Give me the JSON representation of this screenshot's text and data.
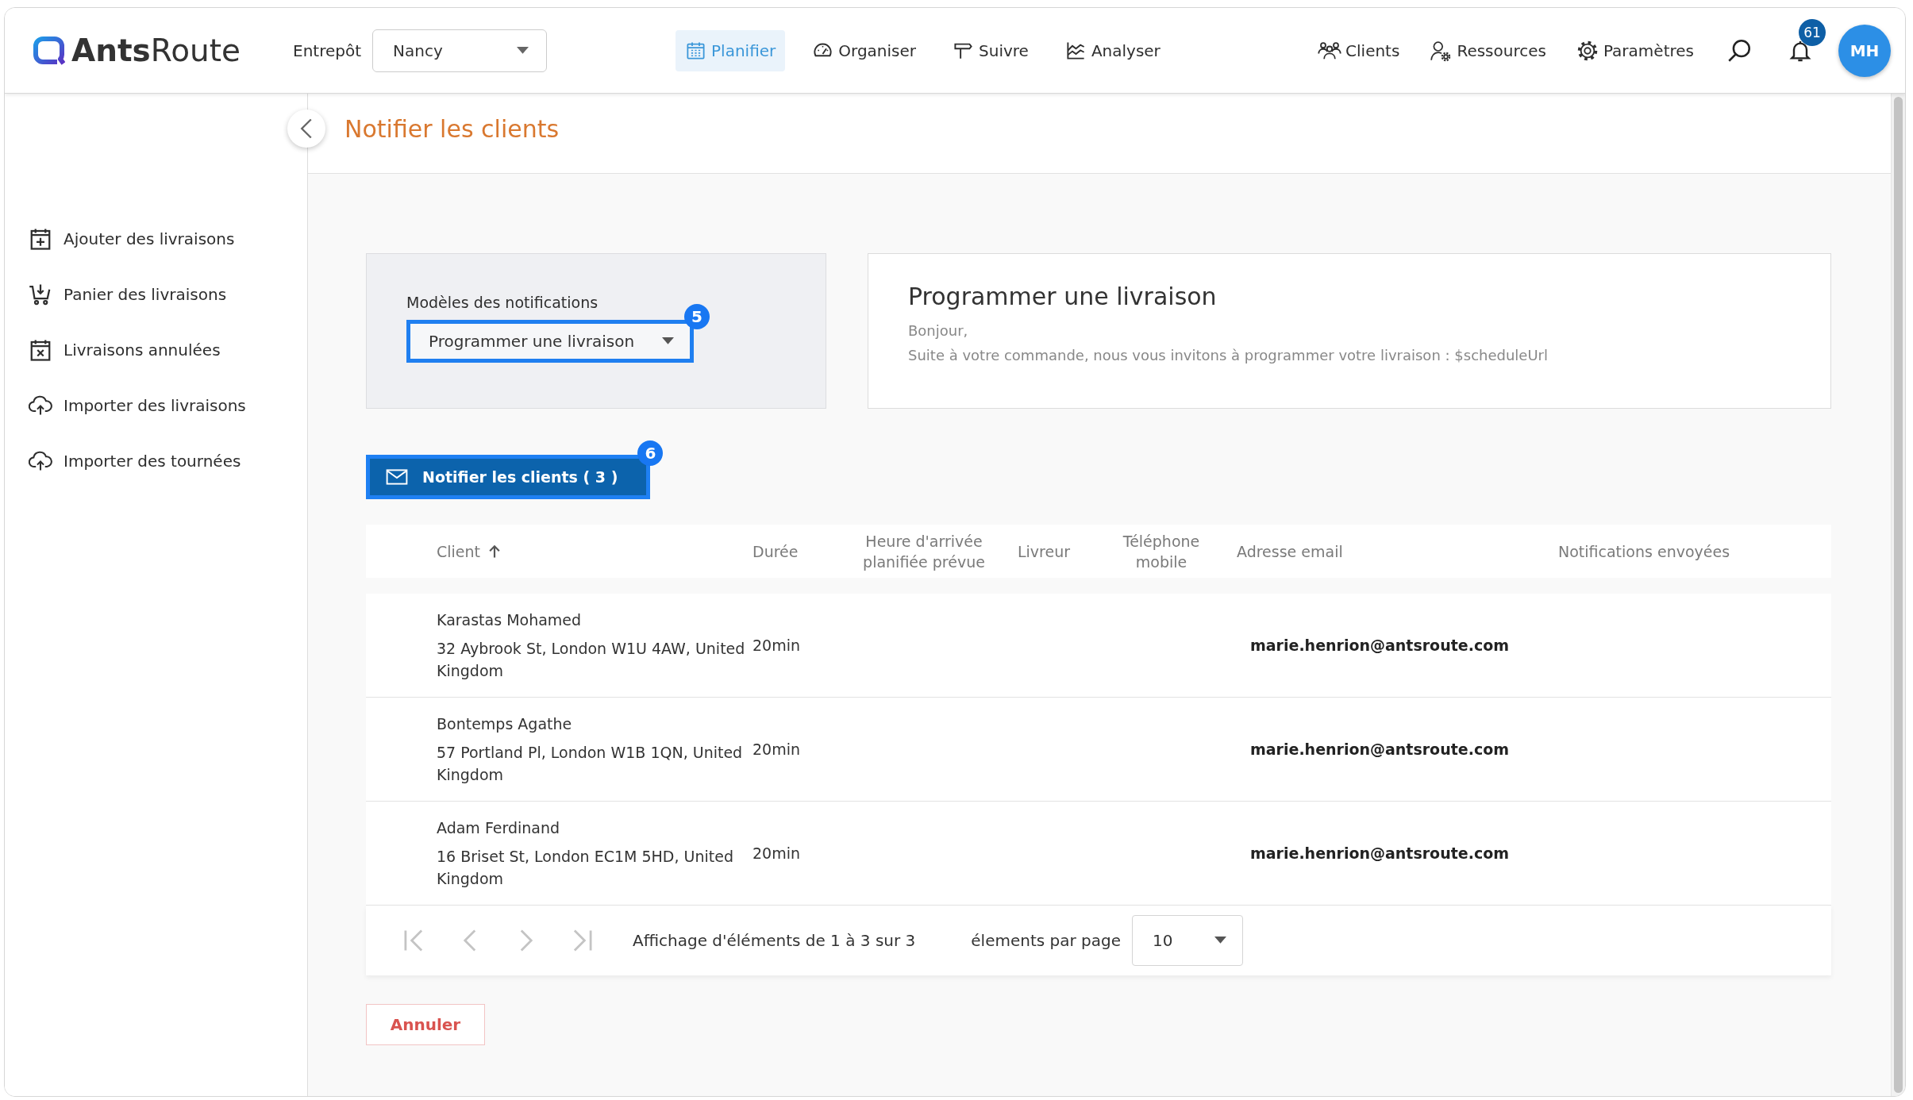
{
  "header": {
    "logo": "**Ants**Route",
    "warehouse_label": "Entrepôt",
    "warehouse": "Nancy",
    "nav": [
      {
        "label": "Planifier",
        "selected": true
      },
      {
        "label": "Organiser",
        "selected": false
      },
      {
        "label": "Suivre",
        "selected": false
      },
      {
        "label": "Analyser",
        "selected": false
      }
    ],
    "menu": [
      {
        "label": "Clients"
      },
      {
        "label": "Ressources"
      },
      {
        "label": "Paramètres"
      }
    ],
    "notifications_count": "61",
    "avatar": "MH"
  },
  "sidebar": {
    "items": [
      {
        "label": "Ajouter des livraisons"
      },
      {
        "label": "Panier des livraisons"
      },
      {
        "label": "Livraisons annulées"
      },
      {
        "label": "Importer des livraisons"
      },
      {
        "label": "Importer des tournées"
      }
    ]
  },
  "page_title": "Notifier les clients",
  "templates": {
    "label": "Modèles des notifications",
    "value": "Programmer une livraison",
    "step": "5"
  },
  "preview": {
    "title": "Programmer une livraison",
    "lines": [
      "Bonjour,",
      "Suite à votre commande, nous vous invitons à programmer votre livraison :  $scheduleUrl"
    ]
  },
  "notify_button": {
    "label": "Notifier les clients ( 3 )",
    "step": "6"
  },
  "table": {
    "columns": [
      {
        "label": "Client",
        "sorted": true
      },
      {
        "label": "Durée",
        "sorted": false
      },
      {
        "label": "Heure d'arrivée planifiée prévue",
        "sorted": false
      },
      {
        "label": "Livreur",
        "sorted": false
      },
      {
        "label": "Téléphone mobile",
        "sorted": false
      },
      {
        "label": "Adresse email",
        "sorted": false
      },
      {
        "label": "Notifications envoyées",
        "sorted": false
      }
    ],
    "rows": [
      {
        "name": "Karastas Mohamed",
        "address": "32 Aybrook St, London W1U 4AW, United Kingdom",
        "duration": "20min",
        "email": "marie.henrion@antsroute.com"
      },
      {
        "name": "Bontemps Agathe",
        "address": "57 Portland Pl, London W1B 1QN, United Kingdom",
        "duration": "20min",
        "email": "marie.henrion@antsroute.com"
      },
      {
        "name": "Adam Ferdinand",
        "address": "16 Briset St, London EC1M 5HD, United Kingdom",
        "duration": "20min",
        "email": "marie.henrion@antsroute.com"
      }
    ]
  },
  "pagination": {
    "buttons": [
      {
        "kind": "first",
        "disabled": true
      },
      {
        "kind": "prev",
        "disabled": true
      },
      {
        "kind": "next",
        "disabled": true
      },
      {
        "kind": "last",
        "disabled": true
      }
    ],
    "summary": "Affichage d'éléments de 1 à 3 sur 3",
    "per_page_label": "élements par page",
    "per_page": "10"
  },
  "cancel_button": "Annuler"
}
